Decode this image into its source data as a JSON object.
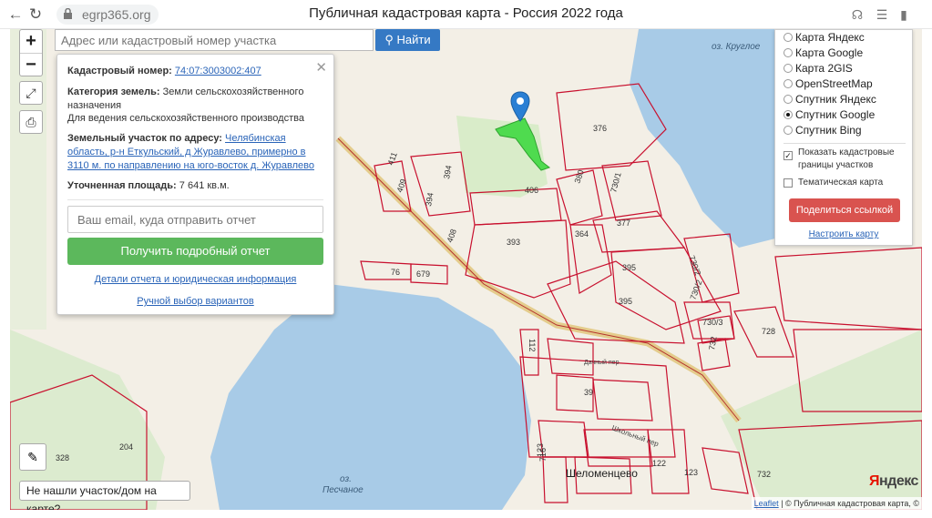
{
  "browser": {
    "url": "egrp365.org",
    "page_title": "Публичная кадастровая карта - Россия 2022 года",
    "icons": [
      "back-icon",
      "reload-icon",
      "lock-icon",
      "headphones-icon",
      "menu-icon",
      "bookmark-icon"
    ]
  },
  "map_controls": {
    "zoom_in": "+",
    "zoom_out": "−"
  },
  "search": {
    "placeholder": "Адрес или кадастровый номер участка",
    "button_label": "Найти"
  },
  "popup": {
    "cadastral_label": "Кадастровый номер:",
    "cadastral_value": "74:07:3003002:407",
    "category_label": "Категория земель:",
    "category_value": "Земли сельскохозяйственного назначения",
    "usage": "Для ведения сельскохозяйственного производства",
    "address_label": "Земельный участок по адресу:",
    "address_value": "Челябинская область, р-н Еткульский, д Журавлево, примерно в 3110 м. по направлению на юго-восток д. Журавлево",
    "area_label": "Уточненная площадь:",
    "area_value": "7 641 кв.м.",
    "email_placeholder": "Ваш email, куда отправить отчет",
    "report_button": "Получить подробный отчет",
    "details_link": "Детали отчета и юридическая информация",
    "manual_link": "Ручной выбор вариантов"
  },
  "layers": {
    "options": [
      {
        "label": "Карта Яндекс",
        "selected": false
      },
      {
        "label": "Карта Google",
        "selected": false
      },
      {
        "label": "Карта 2GIS",
        "selected": false
      },
      {
        "label": "OpenStreetMap",
        "selected": false
      },
      {
        "label": "Спутник Яндекс",
        "selected": false
      },
      {
        "label": "Спутник Google",
        "selected": true
      },
      {
        "label": "Спутник Bing",
        "selected": false
      }
    ],
    "show_borders": "Показать кадастровые границы участков",
    "show_borders_checked": true,
    "thematic": "Тематическая карта",
    "thematic_checked": false,
    "share_button": "Поделиться ссылкой",
    "configure_link": "Настроить карту"
  },
  "map": {
    "lake_north": "оз. Круглое",
    "lake_south_1": "оз.",
    "lake_south_2": "Песчаное",
    "village": "Шеломенцево",
    "street": "Школьный пер",
    "street2": "Дачный пер",
    "parcels": [
      "376",
      "411",
      "409",
      "394",
      "394",
      "408",
      "406",
      "380",
      "730/1",
      "377",
      "393",
      "364",
      "395",
      "730/2",
      "76",
      "679",
      "395",
      "730/2",
      "730/3",
      "728",
      "732",
      "112",
      "123",
      "39",
      "204",
      "328",
      "716",
      "122",
      "123",
      "732"
    ],
    "brand": "Яндекс",
    "colors": {
      "water": "#a8cbe7",
      "parcel": "#c8102e",
      "selected": "#4fdb4f",
      "green": "#d6ebc6"
    }
  },
  "bottom": {
    "not_found": "Не нашли участок/дом на карте?",
    "attribution_leaflet": "Leaflet",
    "attribution_rest": "| © Публичная кадастровая карта, ©"
  }
}
